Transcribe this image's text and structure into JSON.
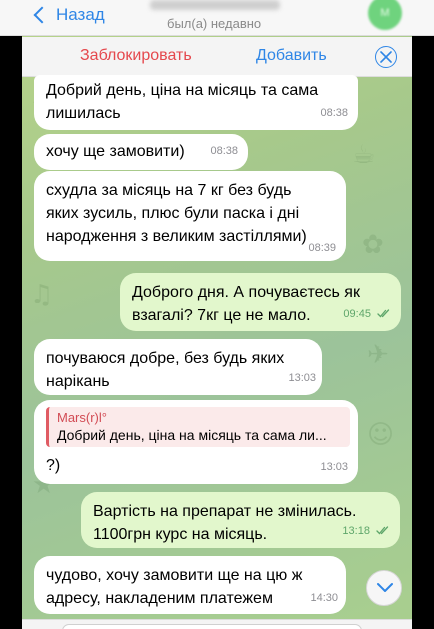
{
  "header": {
    "back_label": "Назад",
    "status": "был(а) недавно",
    "avatar_initials": "М"
  },
  "action_bar": {
    "block_label": "Заблокировать",
    "add_label": "Добавить"
  },
  "messages": [
    {
      "direction": "in",
      "text": "Добрий день, ціна на місяць та сама\nлишилась",
      "time": "08:38"
    },
    {
      "direction": "in",
      "text": "хочу ще замовити)",
      "time": "08:38"
    },
    {
      "direction": "in",
      "text": "схудла за місяць на 7 кг без будь\nяких зусиль, плюс були паска і дні\nнародження з великим застіллями)",
      "time": "08:39"
    },
    {
      "direction": "out",
      "text": "Доброго дня. А почуваєтесь як\nвзагалі? 7кг це не мало.",
      "time": "09:45"
    },
    {
      "direction": "in",
      "text": "почуваюся добре, без будь яких\nнарікань",
      "time": "13:03"
    },
    {
      "direction": "in",
      "reply_author": "Mars(r)l°",
      "reply_text": "Добрий день, ціна на місяць та сама ли...",
      "text": "?)",
      "time": "13:03"
    },
    {
      "direction": "out",
      "text": "Вартість на препарат не змінилась.\n1100грн курс на місяць.",
      "time": "13:18"
    },
    {
      "direction": "in",
      "text": "чудово, хочу замовити ще на цю ж\nадресу, накладеним платежем",
      "time": "14:30"
    }
  ],
  "colors": {
    "accent": "#2f86e6",
    "danger": "#e5484d",
    "outgoing_bubble": "#e2f7cc",
    "incoming_bubble": "#ffffff",
    "read_ticks": "#5ea66a"
  },
  "icons": {
    "back": "chevron-left-icon",
    "close": "close-circle-icon",
    "read": "double-check-icon",
    "scroll": "chevron-down-icon"
  }
}
